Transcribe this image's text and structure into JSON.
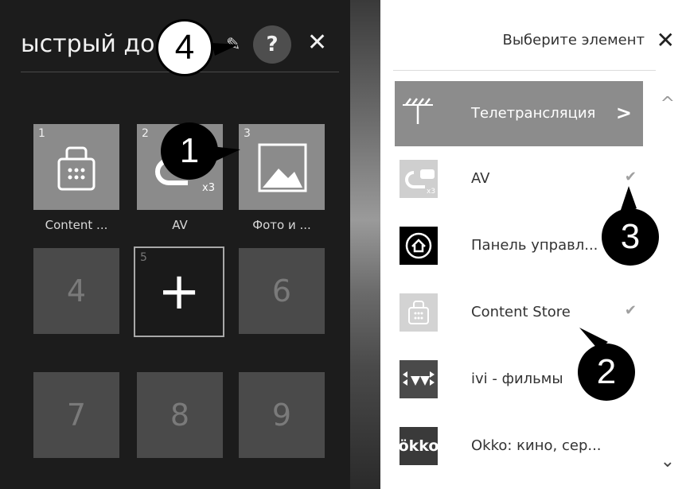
{
  "quick_access": {
    "title": "ыстрый до",
    "edit_icon": "pencil-icon",
    "help_label": "?",
    "close_label": "✕",
    "tiles": [
      {
        "num": "1",
        "label": "Content ...",
        "icon": "shopping-bag-icon"
      },
      {
        "num": "2",
        "label": "AV",
        "icon": "av-plug-icon"
      },
      {
        "num": "3",
        "label": "Фото и ...",
        "icon": "photo-icon"
      },
      {
        "num": "4"
      },
      {
        "num": "5",
        "plus": "+"
      },
      {
        "num": "6"
      },
      {
        "num": "7"
      },
      {
        "num": "8"
      },
      {
        "num": "9"
      }
    ]
  },
  "select_panel": {
    "title": "Выберите элемент",
    "close_label": "✕",
    "items": [
      {
        "label": "Телетрансляция",
        "icon": "antenna-icon",
        "arrow": ">"
      },
      {
        "label": "AV",
        "icon": "av-plug-icon",
        "check": "✔"
      },
      {
        "label": "Панель управл...",
        "icon": "home-dashboard-icon"
      },
      {
        "label": "Content Store",
        "icon": "shopping-bag-icon",
        "check": "✔"
      },
      {
        "label": "ivi - фильмы",
        "icon": "ivi-logo-icon"
      },
      {
        "label": "Okko: кино, сер...",
        "icon": "okko-logo-icon",
        "logo_text": "ökko"
      }
    ],
    "scroll_up": "^",
    "scroll_down": "⌄"
  },
  "callouts": [
    "1",
    "2",
    "3",
    "4"
  ]
}
